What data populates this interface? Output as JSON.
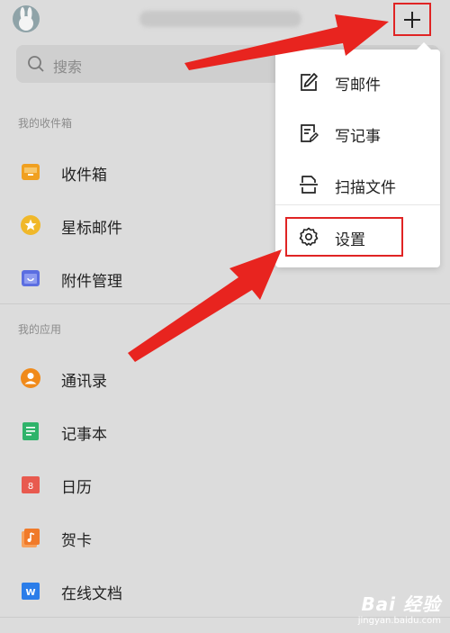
{
  "search": {
    "placeholder": "搜索"
  },
  "sections": {
    "mailbox_title": "我的收件箱",
    "apps_title": "我的应用"
  },
  "mailbox_items": [
    {
      "label": "收件箱",
      "icon": "inbox-icon",
      "color": "#f0a020"
    },
    {
      "label": "星标邮件",
      "icon": "star-icon",
      "color": "#f0b82a"
    },
    {
      "label": "附件管理",
      "icon": "attachment-icon",
      "color": "#5b6ee1"
    }
  ],
  "app_items": [
    {
      "label": "通讯录",
      "icon": "contacts-icon",
      "color": "#f08a1a"
    },
    {
      "label": "记事本",
      "icon": "notepad-icon",
      "color": "#2fb36a"
    },
    {
      "label": "日历",
      "icon": "calendar-icon",
      "color": "#e85a4f",
      "badge": "8"
    },
    {
      "label": "贺卡",
      "icon": "greeting-card-icon",
      "color": "#f07a2a"
    },
    {
      "label": "在线文档",
      "icon": "online-doc-icon",
      "color": "#2b7de9",
      "badge": "W"
    }
  ],
  "menu": {
    "items": [
      {
        "label": "写邮件",
        "icon": "compose-icon"
      },
      {
        "label": "写记事",
        "icon": "write-note-icon"
      },
      {
        "label": "扫描文件",
        "icon": "scan-file-icon"
      },
      {
        "label": "设置",
        "icon": "gear-icon"
      }
    ]
  },
  "colors": {
    "annotation_red": "#e02424"
  },
  "watermark": {
    "line1": "Bai 经验",
    "line2": "jingyan.baidu.com"
  }
}
